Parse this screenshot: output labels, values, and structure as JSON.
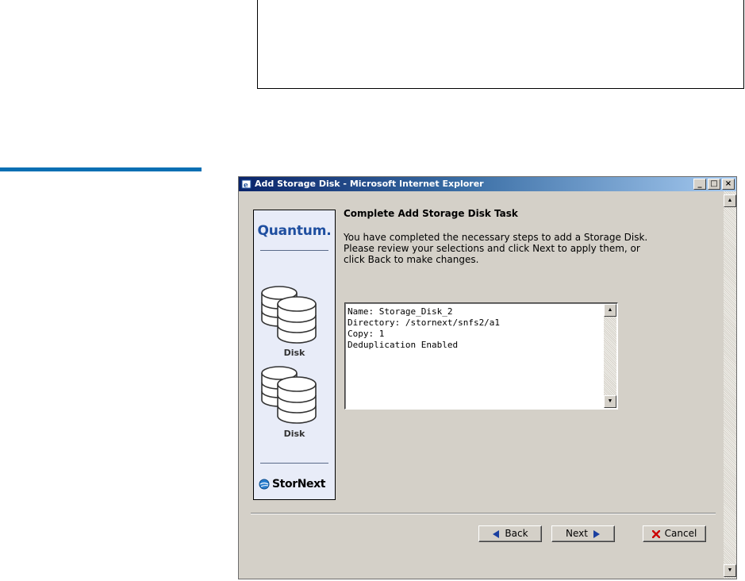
{
  "window": {
    "title": "Add Storage Disk - Microsoft Internet Explorer",
    "controls": {
      "minimize": "_",
      "maximize": "□",
      "close": "×"
    }
  },
  "sidebar": {
    "brand": "Quantum",
    "brand_dot": ".",
    "items": [
      {
        "label": "Disk",
        "icon": "disk-stack-icon"
      },
      {
        "label": "Disk",
        "icon": "disk-stack-icon"
      }
    ],
    "footer_brand": "StorNext"
  },
  "main": {
    "heading": "Complete Add Storage Disk Task",
    "description": "You have completed the necessary steps to add a Storage Disk. Please review your selections and click Next to apply them, or click Back to make changes.",
    "summary_lines": [
      "Name: Storage_Disk_2",
      "Directory: /stornext/snfs2/a1",
      "Copy: 1",
      "Deduplication Enabled"
    ]
  },
  "buttons": {
    "back": "Back",
    "next": "Next",
    "cancel": "Cancel"
  },
  "colors": {
    "accent_rule": "#0a6fb3",
    "title_bar_start": "#0a246a",
    "title_bar_end": "#a6caf0",
    "dialog_bg": "#d4d0c8",
    "side_panel_bg": "#e8ecf8",
    "brand_blue": "#1f4fa0",
    "arrow_blue": "#1a3fa0",
    "cancel_red": "#cc0000"
  }
}
